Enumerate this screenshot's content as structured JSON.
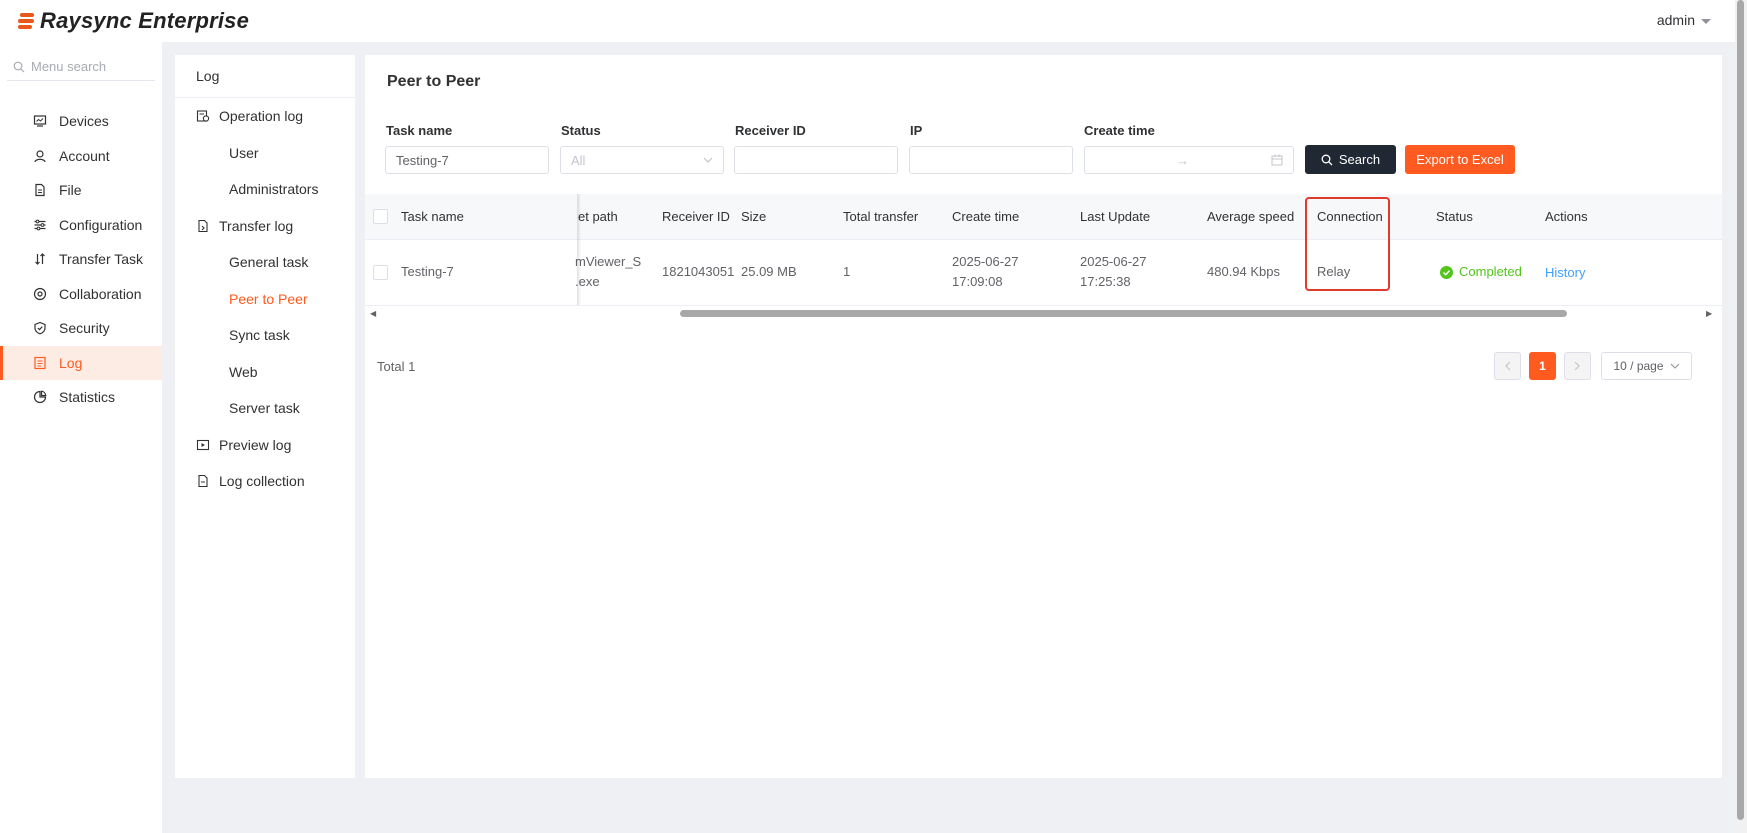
{
  "app": {
    "brand": "Raysync Enterprise",
    "user": "admin"
  },
  "sidebar": {
    "search_placeholder": "Menu search",
    "items": [
      {
        "label": "Devices",
        "icon": "devices-icon"
      },
      {
        "label": "Account",
        "icon": "account-icon"
      },
      {
        "label": "File",
        "icon": "file-icon"
      },
      {
        "label": "Configuration",
        "icon": "configuration-icon"
      },
      {
        "label": "Transfer Task",
        "icon": "transfer-task-icon"
      },
      {
        "label": "Collaboration",
        "icon": "collaboration-icon"
      },
      {
        "label": "Security",
        "icon": "security-icon"
      },
      {
        "label": "Log",
        "icon": "log-icon",
        "active": true
      },
      {
        "label": "Statistics",
        "icon": "statistics-icon"
      }
    ]
  },
  "subnav": {
    "header": "Log",
    "operation_log": "Operation log",
    "operation_items": [
      "User",
      "Administrators"
    ],
    "transfer_log": "Transfer log",
    "transfer_items": [
      "General task",
      "Peer to Peer",
      "Sync task",
      "Web",
      "Server task"
    ],
    "preview_log": "Preview log",
    "log_collection": "Log collection",
    "active": "Peer to Peer"
  },
  "page": {
    "title": "Peer to Peer"
  },
  "filters": {
    "task_name_label": "Task name",
    "task_name_value": "Testing-7",
    "status_label": "Status",
    "status_value": "All",
    "receiver_label": "Receiver ID",
    "ip_label": "IP",
    "create_time_label": "Create time",
    "range_arrow": "→",
    "search_label": "Search",
    "export_label": "Export to Excel"
  },
  "table": {
    "headers": {
      "task_name": "Task name",
      "target_path": "et path",
      "receiver_id": "Receiver ID",
      "size": "Size",
      "total_transfer": "Total transfer",
      "create_time": "Create time",
      "last_update": "Last Update",
      "average_speed": "Average speed",
      "connection": "Connection",
      "status": "Status",
      "actions": "Actions"
    },
    "row": {
      "task_name": "Testing-7",
      "path_line1": "mViewer_S",
      "path_line2": ".exe",
      "receiver_id": "1821043051",
      "size": "25.09 MB",
      "total_transfer": "1",
      "create_date": "2025-06-27",
      "create_clock": "17:09:08",
      "update_date": "2025-06-27",
      "update_clock": "17:25:38",
      "average_speed": "480.94 Kbps",
      "connection": "Relay",
      "status": "Completed",
      "action": "History"
    }
  },
  "pagination": {
    "total": "Total 1",
    "current": "1",
    "page_size": "10 / page"
  },
  "colors": {
    "accent": "#ff5a1f",
    "dark": "#1f2833",
    "success": "#52c41a",
    "link": "#409eff",
    "highlight": "#e03b2a"
  }
}
